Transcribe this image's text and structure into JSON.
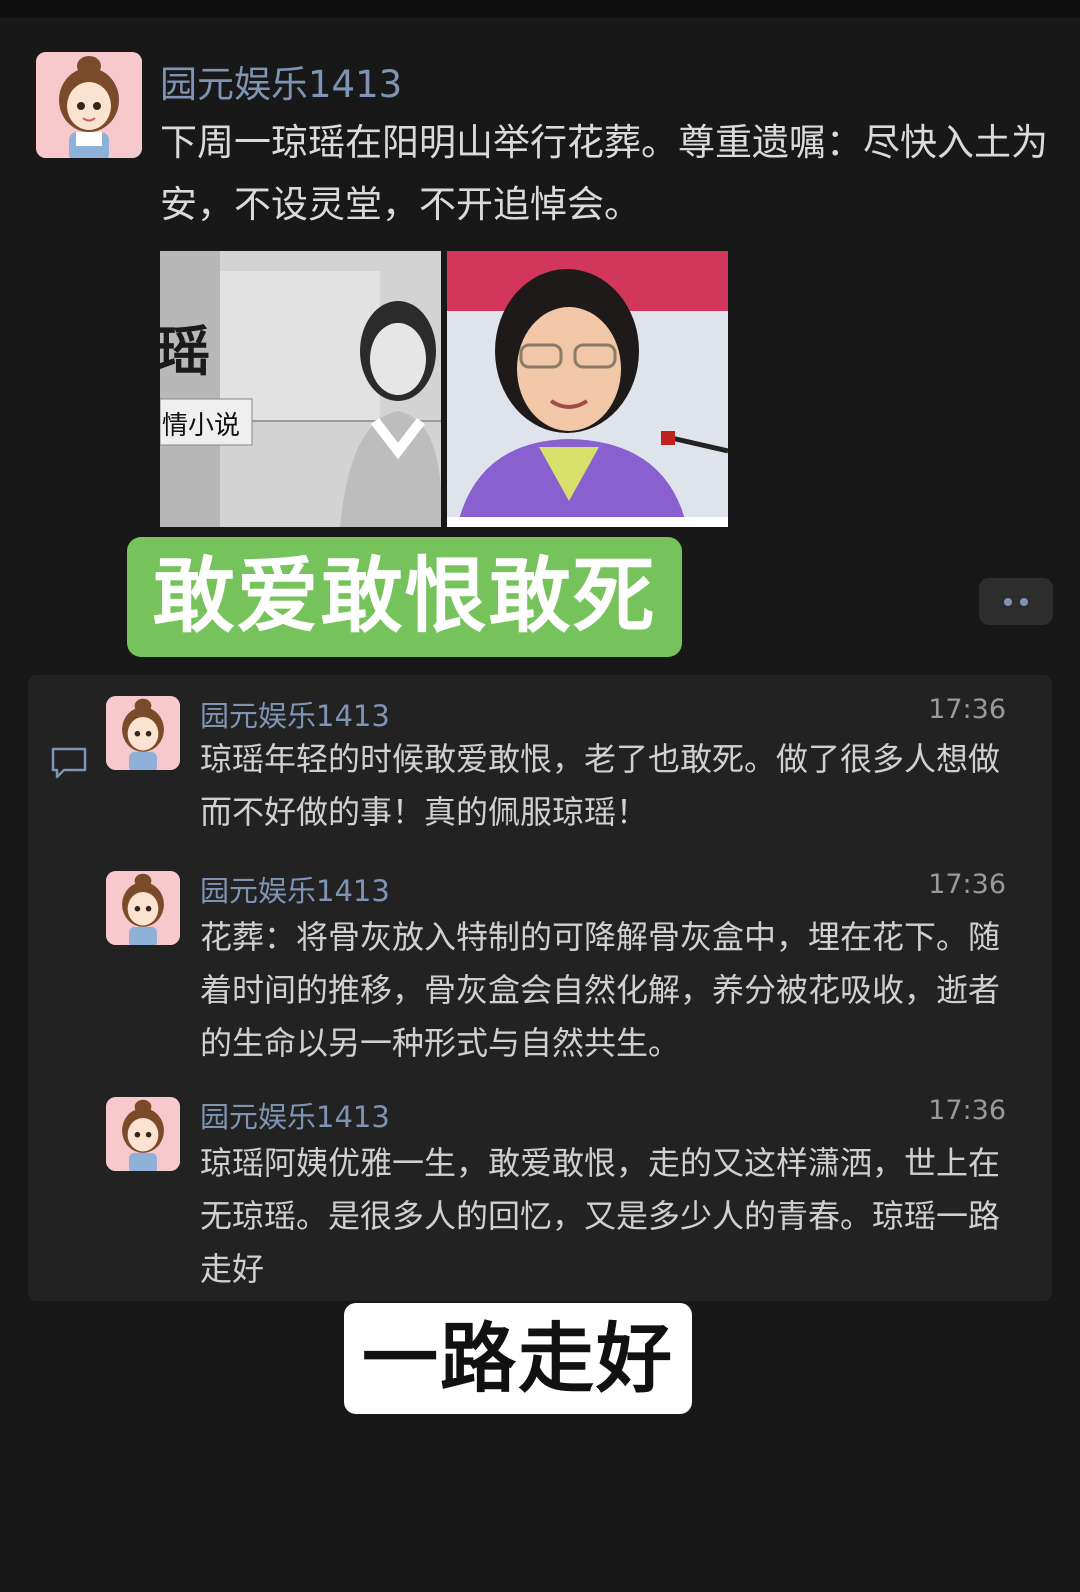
{
  "post": {
    "author": "园元娱乐1413",
    "text": "下周一琼瑶在阳明山举行花葬。尊重遗嘱：尽快入土为安，不设灵堂，不开追悼会。",
    "photo1_caption_big": "瑶",
    "photo1_caption_small": "情小说"
  },
  "banner_top": "敢爱敢恨敢死",
  "banner_bottom": "一路走好",
  "comments": [
    {
      "author": "园元娱乐1413",
      "time": "17:36",
      "text": "琼瑶年轻的时候敢爱敢恨，老了也敢死。做了很多人想做而不好做的事！真的佩服琼瑶！"
    },
    {
      "author": "园元娱乐1413",
      "time": "17:36",
      "text": "花葬：将骨灰放入特制的可降解骨灰盒中，埋在花下。随着时间的推移，骨灰盒会自然化解，养分被花吸收，逝者的生命以另一种形式与自然共生。"
    },
    {
      "author": "园元娱乐1413",
      "time": "17:36",
      "text": "琼瑶阿姨优雅一生，敢爱敢恨，走的又这样潇洒，世上在无琼瑶。是很多人的回忆，又是多少人的青春。琼瑶一路走好"
    }
  ],
  "icons": {
    "more": "more-dots-icon",
    "comment": "comment-icon"
  },
  "colors": {
    "name": "#7f93b3",
    "banner_green": "#76c35c",
    "background": "#181818",
    "comment_bg": "#222222"
  }
}
